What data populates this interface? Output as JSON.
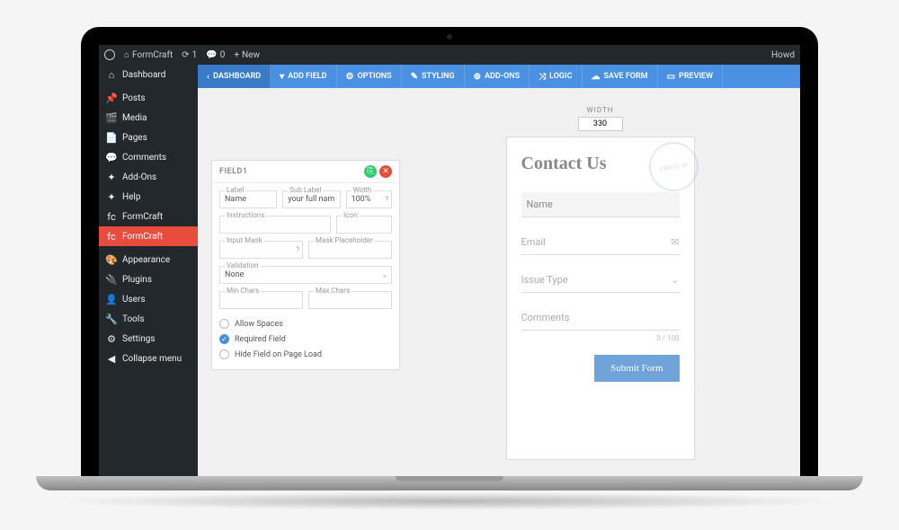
{
  "adminbar": {
    "site": "FormCraft",
    "updates": "1",
    "comments": "0",
    "new": "New",
    "howdy": "Howd"
  },
  "sidebar": {
    "items": [
      {
        "icon": "⌂",
        "label": "Dashboard"
      },
      {
        "icon": "📌",
        "label": "Posts"
      },
      {
        "icon": "🎬",
        "label": "Media"
      },
      {
        "icon": "📄",
        "label": "Pages"
      },
      {
        "icon": "💬",
        "label": "Comments"
      },
      {
        "icon": "✦",
        "label": "Add-Ons"
      },
      {
        "icon": "✦",
        "label": "Help"
      },
      {
        "icon": "fc",
        "label": "FormCraft"
      },
      {
        "icon": "fc",
        "label": "FormCraft"
      },
      {
        "icon": "🎨",
        "label": "Appearance"
      },
      {
        "icon": "🔌",
        "label": "Plugins"
      },
      {
        "icon": "👤",
        "label": "Users"
      },
      {
        "icon": "🔧",
        "label": "Tools"
      },
      {
        "icon": "⚙",
        "label": "Settings"
      },
      {
        "icon": "◀",
        "label": "Collapse menu"
      }
    ],
    "active_index": 8
  },
  "toolbar": [
    {
      "icon": "‹",
      "label": "DASHBOARD"
    },
    {
      "icon": "▾",
      "label": "ADD FIELD"
    },
    {
      "icon": "⚙",
      "label": "OPTIONS"
    },
    {
      "icon": "✎",
      "label": "STYLING"
    },
    {
      "icon": "⊕",
      "label": "ADD-ONS"
    },
    {
      "icon": "⤨",
      "label": "LOGIC"
    },
    {
      "icon": "☁",
      "label": "SAVE FORM"
    },
    {
      "icon": "▭",
      "label": "PREVIEW"
    }
  ],
  "panel": {
    "title": "FIELD1",
    "label": {
      "lbl": "Label",
      "val": "Name"
    },
    "sublabel": {
      "lbl": "Sub Label",
      "val": "your full nam"
    },
    "width": {
      "lbl": "Width",
      "val": "100%"
    },
    "instructions": {
      "lbl": "Instructions",
      "val": ""
    },
    "icon": {
      "lbl": "Icon:",
      "val": ""
    },
    "inputmask": {
      "lbl": "Input Mask",
      "val": ""
    },
    "maskph": {
      "lbl": "Mask Placeholder",
      "val": ""
    },
    "validation": {
      "lbl": "Validation",
      "val": "None"
    },
    "minchars": {
      "lbl": "Min Chars",
      "val": ""
    },
    "maxchars": {
      "lbl": "Max Chars",
      "val": ""
    },
    "allow_spaces": "Allow Spaces",
    "required": "Required Field",
    "hide": "Hide Field on Page Load"
  },
  "preview": {
    "width_label": "WIDTH",
    "width_value": "330",
    "title": "Contact Us",
    "stamp": "EMAIL M",
    "fields": [
      {
        "label": "Name",
        "icon": ""
      },
      {
        "label": "Email",
        "icon": "✉"
      },
      {
        "label": "Issue Type",
        "icon": "⌄"
      },
      {
        "label": "Comments",
        "icon": ""
      }
    ],
    "char_count": "0 / 100",
    "submit": "Submit Form"
  }
}
